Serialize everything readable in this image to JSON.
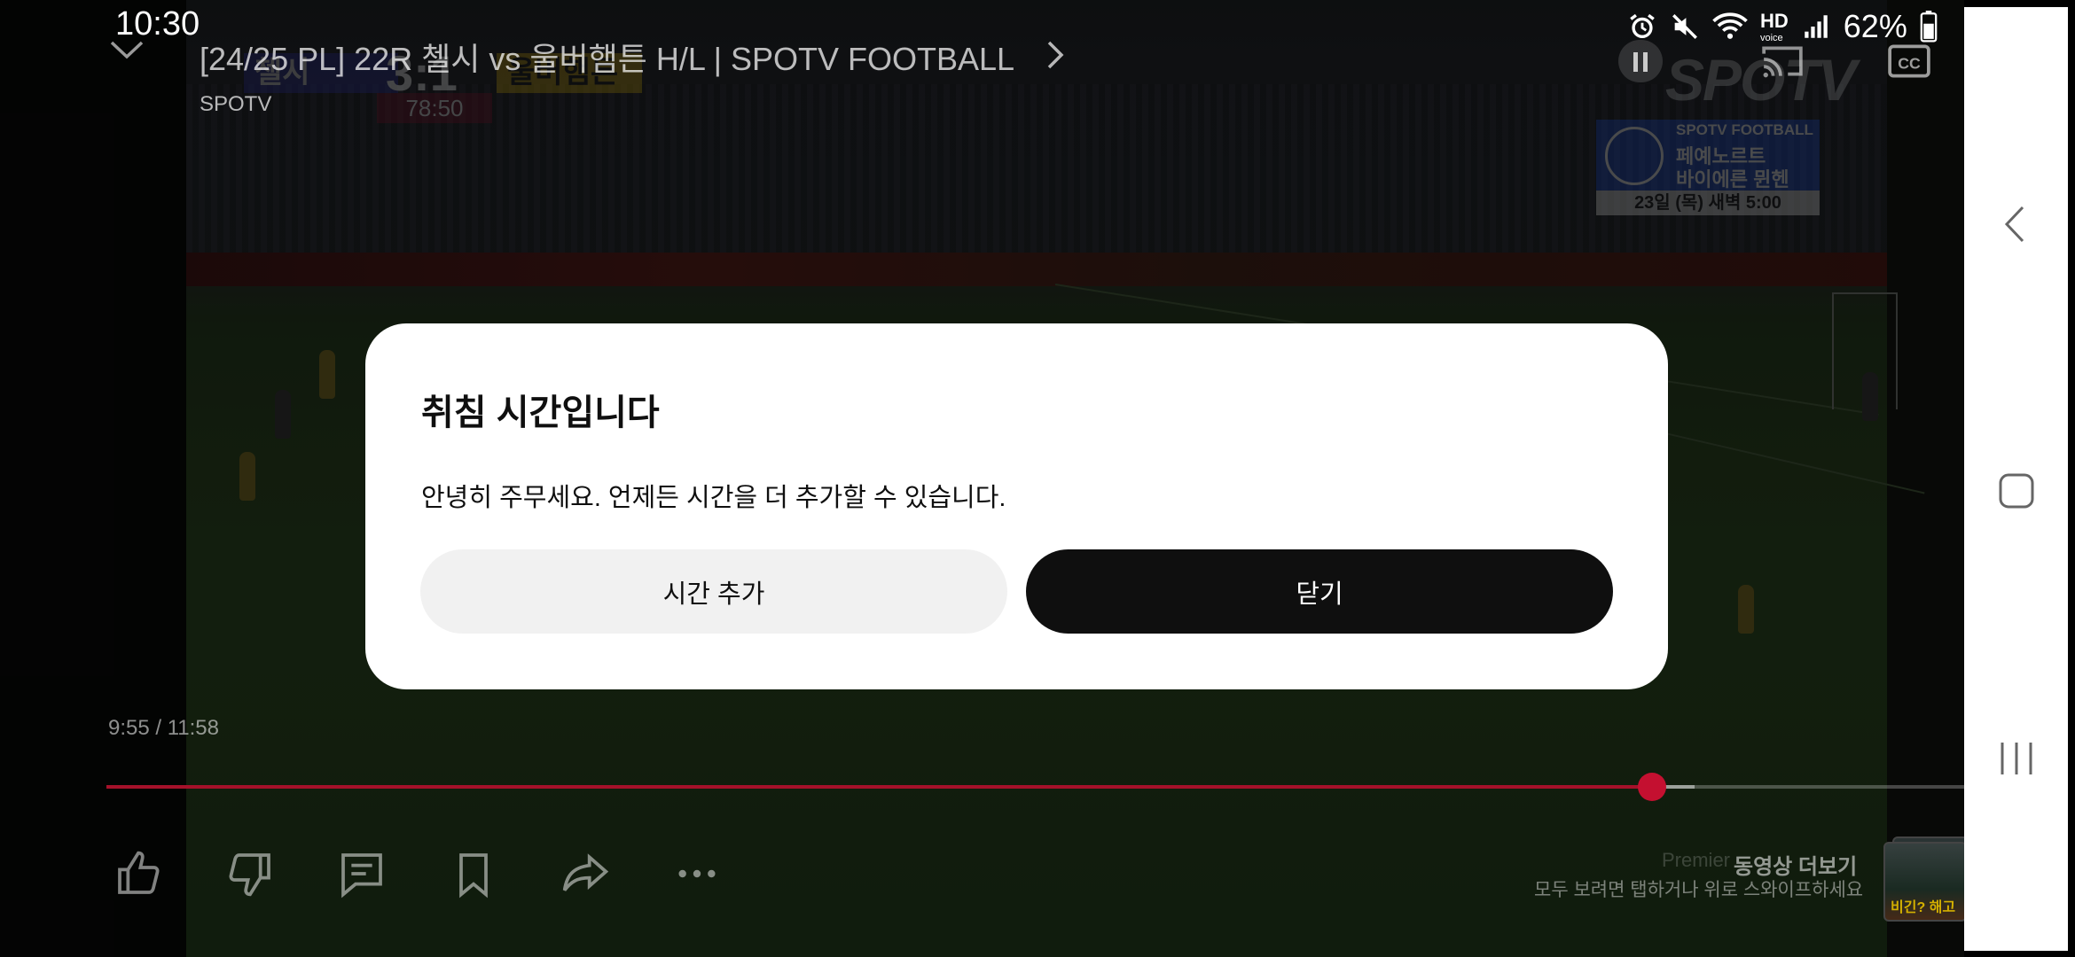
{
  "status_bar": {
    "time": "10:30",
    "hd_label": "HD",
    "voice_label": "voice",
    "battery": "62%",
    "icons": [
      "alarm-icon",
      "mute-icon",
      "wifi-icon",
      "hd-voice-icon",
      "signal-icon",
      "battery-icon"
    ]
  },
  "player": {
    "title": "[24/25 PL] 22R 첼시 vs 울버햄튼 H/L | SPOTV FOOTBALL",
    "channel": "SPOTV",
    "watermark": "SPOTV",
    "current_time": "9:55",
    "duration": "11:58",
    "time_display": "9:55 / 11:58",
    "progress_fraction": 0.832,
    "buffer_fraction": 0.855,
    "colors": {
      "progress": "#a5112a",
      "thumb": "#c41030"
    }
  },
  "video_overlay": {
    "scoreboard": {
      "home": "첼시",
      "away": "울버햄튼",
      "score": "3:1",
      "clock": "78:50"
    },
    "promo": {
      "line1": "SPOTV FOOTBALL",
      "line2": "페예노르트",
      "line3": "바이에른 뮌헨",
      "schedule": "23일 (목) 새벽 5:00"
    }
  },
  "actions": {
    "like_icon": "thumbs-up-icon",
    "dislike_icon": "thumbs-down-icon",
    "comments_icon": "comment-icon",
    "save_icon": "bookmark-icon",
    "share_icon": "share-icon",
    "more_icon": "more-horizontal-icon"
  },
  "more_videos": {
    "label": "Premier",
    "title": "동영상 더보기",
    "hint": "모두 보려면 탭하거나 위로 스와이프하세요",
    "thumb_caption": "비긴? 해고"
  },
  "dialog": {
    "title": "취침 시간입니다",
    "message": "안녕히 주무세요. 언제든 시간을 더 추가할 수 있습니다.",
    "add_time_label": "시간 추가",
    "close_label": "닫기",
    "colors": {
      "secondary_bg": "#f1f1f1",
      "primary_bg": "#0f0f0f"
    }
  },
  "navbar": {
    "back_icon": "back-icon",
    "home_icon": "home-icon",
    "recents_icon": "recents-icon"
  }
}
